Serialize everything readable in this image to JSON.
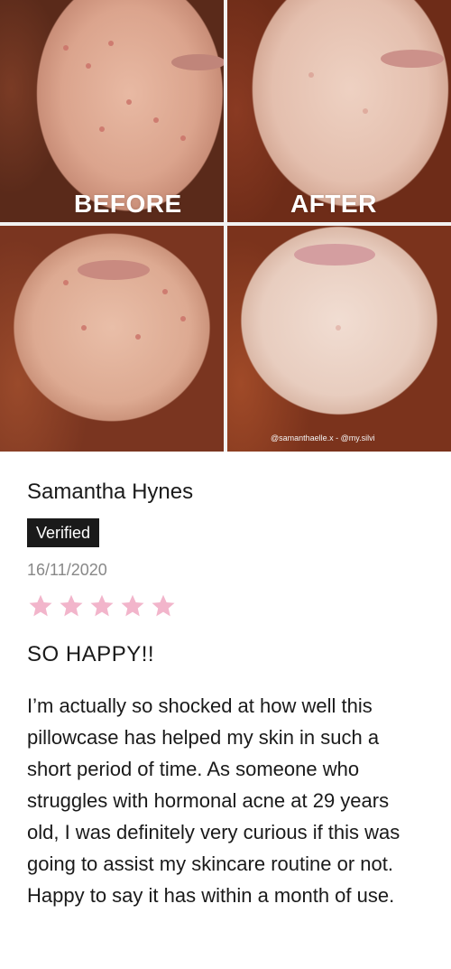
{
  "photos": {
    "before_label": "BEFORE",
    "after_label": "AFTER",
    "watermark": "@samanthaelle.x - @my.silvi"
  },
  "review": {
    "name": "Samantha Hynes",
    "badge": "Verified",
    "date": "16/11/2020",
    "rating": 5,
    "rating_max": 5,
    "star_color": "#f2b5cb",
    "title": "SO HAPPY!!",
    "body": "I’m actually so shocked at how well this pillowcase has helped my skin in such a short period of time. As someone who struggles with hormonal acne at 29 years old, I was definitely very curious if this was going to assist my skincare routine or not. Happy to say it has within a month of use."
  }
}
